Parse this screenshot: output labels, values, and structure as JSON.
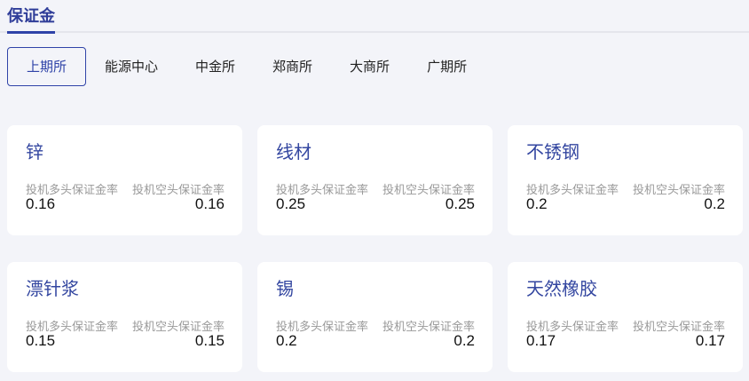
{
  "header": {
    "title": "保证金"
  },
  "tabs": [
    {
      "label": "上期所",
      "active": true
    },
    {
      "label": "能源中心"
    },
    {
      "label": "中金所"
    },
    {
      "label": "郑商所"
    },
    {
      "label": "大商所"
    },
    {
      "label": "广期所"
    }
  ],
  "labels": {
    "long": "投机多头保证金率",
    "short": "投机空头保证金率"
  },
  "cards": [
    {
      "name": "锌",
      "long": "0.16",
      "short": "0.16"
    },
    {
      "name": "线材",
      "long": "0.25",
      "short": "0.25"
    },
    {
      "name": "不锈钢",
      "long": "0.2",
      "short": "0.2"
    },
    {
      "name": "漂针浆",
      "long": "0.15",
      "short": "0.15"
    },
    {
      "name": "锡",
      "long": "0.2",
      "short": "0.2"
    },
    {
      "name": "天然橡胶",
      "long": "0.17",
      "short": "0.17"
    }
  ]
}
